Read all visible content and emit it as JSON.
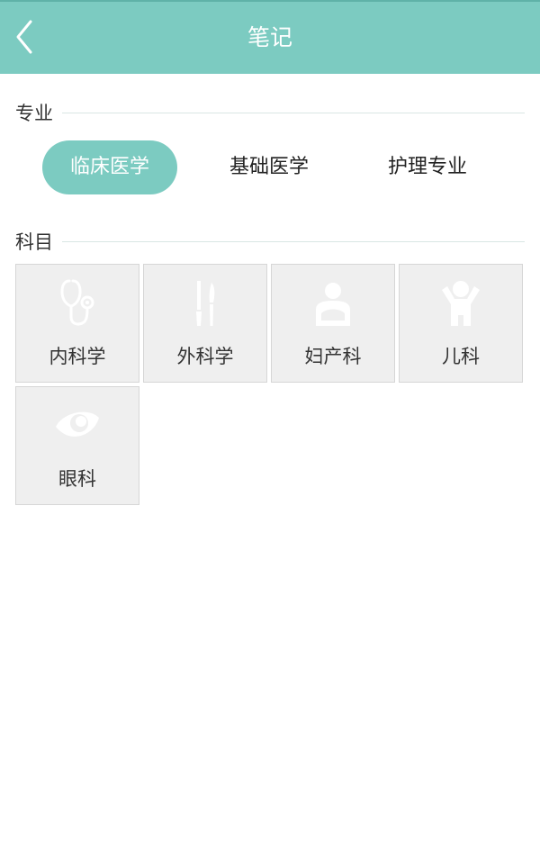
{
  "header": {
    "title": "笔记",
    "back_icon": "chevron-left-icon"
  },
  "major_section": {
    "heading": "专业",
    "tabs": [
      {
        "label": "临床医学",
        "active": true
      },
      {
        "label": "基础医学",
        "active": false
      },
      {
        "label": "护理专业",
        "active": false
      }
    ]
  },
  "subject_section": {
    "heading": "科目",
    "subjects": [
      {
        "label": "内科学",
        "icon": "stethoscope-icon"
      },
      {
        "label": "外科学",
        "icon": "scalpel-icon"
      },
      {
        "label": "妇产科",
        "icon": "mother-baby-icon"
      },
      {
        "label": "儿科",
        "icon": "child-icon"
      },
      {
        "label": "眼科",
        "icon": "eye-icon"
      }
    ]
  },
  "colors": {
    "accent": "#7ccbc1",
    "cell_bg": "#efefef",
    "icon_fill": "#ffffff"
  }
}
